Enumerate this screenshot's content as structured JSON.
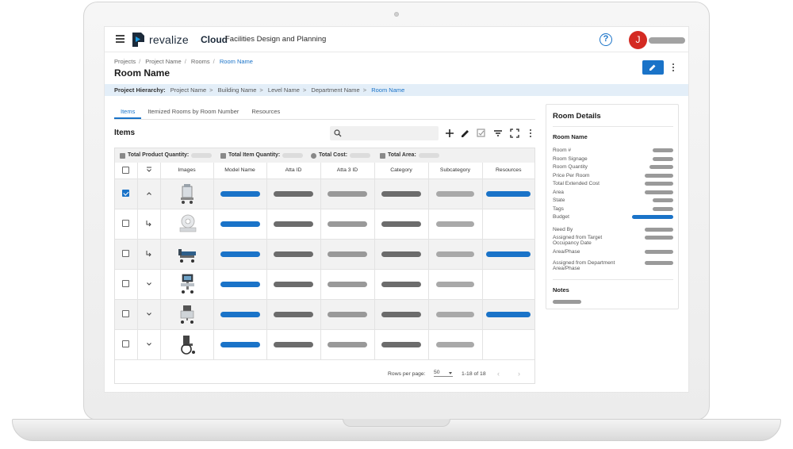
{
  "header": {
    "brand": "revalize",
    "brand_cloud": "Cloud",
    "subtitle": "Facilities Design and Planning",
    "help_icon": "?",
    "avatar_initial": "J",
    "accent_color": "#1a73c8"
  },
  "breadcrumb": [
    "Projects",
    "Project Name",
    "Rooms",
    "Room Name"
  ],
  "page_title": "Room Name",
  "hierarchy": {
    "label": "Project Hierarchy:",
    "path": [
      "Project Name",
      "Building Name",
      "Level Name",
      "Department Name",
      "Room Name"
    ]
  },
  "tabs": [
    "Items",
    "Itemized Rooms by Room Number",
    "Resources"
  ],
  "items_title": "Items",
  "search": {
    "placeholder": ""
  },
  "totals": {
    "product_quantity": "Total Product Quantity:",
    "item_quantity": "Total Item Quantity:",
    "cost": "Total Cost:",
    "area": "Total Area:"
  },
  "table": {
    "columns": [
      "Images",
      "Model Name",
      "Atta ID",
      "Atta 3 ID",
      "Category",
      "Subcategory",
      "Resources"
    ],
    "rows": [
      {
        "checked": true,
        "expander": "chevron-up",
        "image": "medical-cart-icon",
        "has_resources": true
      },
      {
        "checked": false,
        "expander": "child-arrow",
        "image": "imaging-device-icon",
        "has_resources": false
      },
      {
        "checked": false,
        "expander": "child-arrow",
        "image": "hospital-bed-icon",
        "has_resources": true
      },
      {
        "checked": false,
        "expander": "chevron-down",
        "image": "monitor-cart-icon",
        "has_resources": false
      },
      {
        "checked": false,
        "expander": "chevron-down",
        "image": "equipment-cart-icon",
        "has_resources": true
      },
      {
        "checked": false,
        "expander": "chevron-down",
        "image": "wheelchair-icon",
        "has_resources": false
      }
    ]
  },
  "pager": {
    "rows_per_page_label": "Rows per page:",
    "rows_per_page": "50",
    "range": "1-18 of 18",
    "prev": "‹",
    "next": "›"
  },
  "details": {
    "title": "Room Details",
    "section": "Room Name",
    "fields": [
      "Room #",
      "Room Signage",
      "Room Quantity",
      "Price Per Room",
      "Total Extended Cost",
      "Area",
      "State",
      "Tags",
      "Budget"
    ],
    "need_by": "Need By",
    "assigned_target": "Assigned from Target Occupancy Date",
    "area_phase": "Area/Phase",
    "assigned_dept": "Assigned from Department Area/Phase",
    "notes": "Notes"
  }
}
